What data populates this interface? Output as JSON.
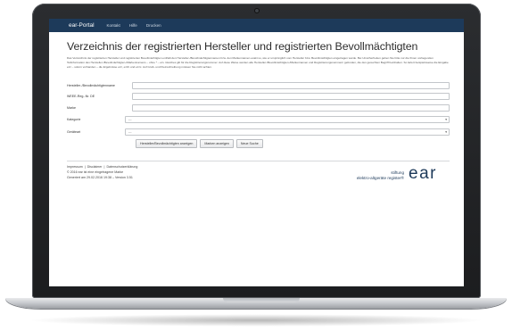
{
  "portal": {
    "brand": "ear-Portal",
    "nav": [
      "Kontakt",
      "Hilfe",
      "Drucken"
    ]
  },
  "page": {
    "title": "Verzeichnis der registrierten Hersteller und registrierten Bevollmächtigten",
    "intro": "Das Verzeichnis der registrierten Hersteller und registrierten Bevollmächtigten enthält den Hersteller-/Bevollmächtigtennamen bzw. den Markennamen exakt so, wie er ursprünglich vom Hersteller bzw. Bevollmächtigten eingetragen wurde. Bei Unsicherheiten geben Sie bitte nur die Ihnen vorliegenden Teilinformation des Hersteller-/Bevollmächtigten-/Markennamens – ohne * – ein. Gleiches gilt für die Registrierungsnummer. Auf diese Weise werden alle Hersteller-/Bevollmächtigten-/Markennamen und Registrierungsnummern gefunden, die den gesuchten Begriff beinhalten. So liefert beispielsweise die Eingabe ezz – sofern vorhanden – die Ergebnisse ezz, ezzb und ezzc. Auf Groß- und Kleinschreibung müssen Sie nicht achten."
  },
  "form": {
    "manufacturer_label": "Hersteller-/Bevollmächtigtenname",
    "weee_label": "WEEE-Reg.-Nr. DE",
    "brand_label": "Marke",
    "category_label": "Kategorie",
    "category_value": "---",
    "device_type_label": "Geräteart",
    "device_type_value": "---",
    "btn_show_manufacturers": "Hersteller/Bevollmächtigten anzeigen",
    "btn_show_brands": "Marken anzeigen",
    "btn_new_search": "Neue Suche"
  },
  "footer": {
    "impressum": "Impressum",
    "disclaimer": "Disclaimer",
    "privacy": "Datenschutzerklärung",
    "separator": "|",
    "copyright": "© 2016 ear ist eine eingetragene Marke",
    "generated": "Generiert am 29.02.2016 19:38 – Version 3.51",
    "logo_line1": "stiftung",
    "logo_line2": "elektro-altgeräte register®",
    "logo_mark": "ear"
  },
  "icons": {
    "select_arrow": "chevron-down-icon",
    "camera": "camera-icon"
  },
  "colors": {
    "navbar": "#1d3a5a",
    "brand_blue": "#1d3a5a",
    "bezel": "#2b2d30"
  }
}
